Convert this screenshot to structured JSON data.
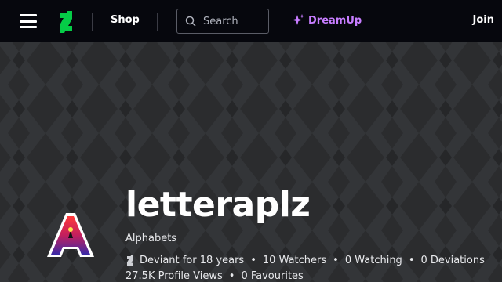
{
  "nav": {
    "shop_label": "Shop",
    "search_placeholder": "Search",
    "dreamup_label": "DreamUp",
    "join_label": "Join"
  },
  "profile": {
    "username": "letteraplz",
    "tagline": "Alphabets",
    "stats": {
      "membership": "Deviant for 18 years",
      "watchers": "10 Watchers",
      "watching": "0 Watching",
      "deviations": "0 Deviations",
      "profile_views": "27.5K Profile Views",
      "favourites": "0 Favourites"
    }
  },
  "colors": {
    "topbar_bg": "#06070d",
    "brand_green": "#05cc47",
    "dreamup_purple": "#c77dff",
    "banner_bg": "#2b2c2e"
  }
}
